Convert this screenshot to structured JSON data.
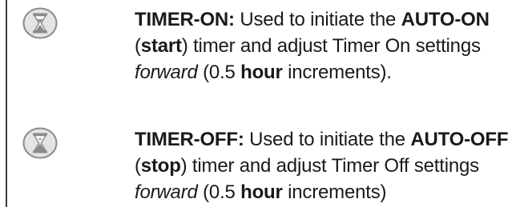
{
  "entries": [
    {
      "icon": "hourglass-button-icon",
      "label": "TIMER-ON:",
      "text_1": " Used to initiate the ",
      "mode": "AUTO-ON",
      "text_2": " (",
      "action": "start",
      "text_3": ") timer and adjust Timer On settings ",
      "direction": "forward",
      "text_4": " (0.5 ",
      "unit": "hour",
      "text_5": " increments)."
    },
    {
      "icon": "hourglass-button-icon",
      "label": "TIMER-OFF:",
      "text_1": " Used to initiate the ",
      "mode": "AUTO-OFF",
      "text_2": " (",
      "action": "stop",
      "text_3": ") timer and adjust Timer Off settings ",
      "direction": "forward",
      "text_4": " (0.5 ",
      "unit": "hour",
      "text_5": " increments)"
    }
  ]
}
